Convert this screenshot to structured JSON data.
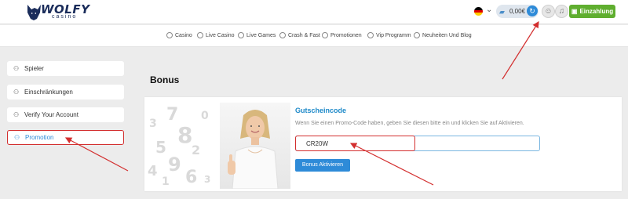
{
  "header": {
    "logo_text": "WOLFY",
    "logo_sub": "casino",
    "balance": "0,00€",
    "deposit_label": "Einzahlung"
  },
  "nav": {
    "items": [
      {
        "label": "Casino",
        "icon": "casino-chip-icon"
      },
      {
        "label": "Live Casino",
        "icon": "live-casino-icon"
      },
      {
        "label": "Live Games",
        "icon": "live-games-icon"
      },
      {
        "label": "Crash & Fast",
        "icon": "rocket-icon"
      },
      {
        "label": "Promotionen",
        "icon": "gift-icon"
      },
      {
        "label": "Vip Programm",
        "icon": "crown-icon"
      },
      {
        "label": "Neuheiten Und Blog",
        "icon": "news-icon"
      }
    ]
  },
  "sidebar": {
    "items": [
      {
        "label": "Spieler",
        "icon": "user-icon"
      },
      {
        "label": "Einschränkungen",
        "icon": "restriction-icon"
      },
      {
        "label": "Verify Your Account",
        "icon": "verify-user-icon"
      },
      {
        "label": "Promotion",
        "icon": "promotion-user-icon",
        "active": true
      }
    ]
  },
  "main": {
    "title": "Bonus",
    "voucher": {
      "title": "Gutscheincode",
      "text": "Wenn Sie einen Promo-Code haben, geben Sie diesen bitte ein und klicken Sie auf Aktivieren.",
      "input_value": "CR20W",
      "button_label": "Bonus Aktivieren"
    }
  },
  "colors": {
    "accent_blue": "#2e8bd8",
    "deposit_green": "#5fae2f",
    "annotation_red": "#d32f2f",
    "logo_navy": "#1b2d5b"
  }
}
